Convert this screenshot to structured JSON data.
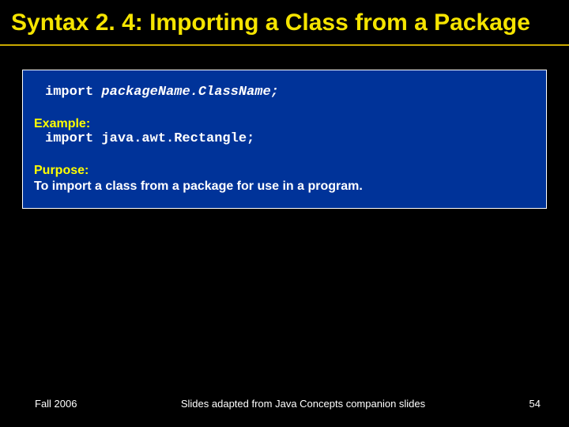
{
  "title": "Syntax 2. 4: Importing a Class from a Package",
  "syntax": {
    "keyword": "import ",
    "generic": "packageName.ClassName;"
  },
  "example": {
    "label": "Example:",
    "code": "import java.awt.Rectangle;"
  },
  "purpose": {
    "label": "Purpose:",
    "text": "To import a class from a package for use in a program."
  },
  "footer": {
    "left": "Fall 2006",
    "center": "Slides adapted from Java Concepts companion slides",
    "right": "54"
  }
}
